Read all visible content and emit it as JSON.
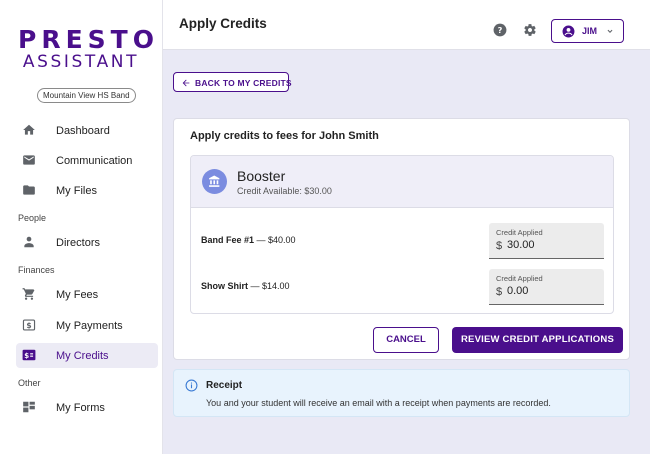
{
  "app": {
    "logo_top": "PRESTO",
    "logo_bottom": "ASSISTANT",
    "org_name": "Mountain View HS Band",
    "brand_color": "#4a0f8c"
  },
  "sidebar": {
    "items": [
      {
        "label": "Dashboard",
        "icon": "home-icon"
      },
      {
        "label": "Communication",
        "icon": "mail-icon"
      },
      {
        "label": "My Files",
        "icon": "folder-icon"
      },
      {
        "label": "Directors",
        "icon": "person-icon"
      },
      {
        "label": "My Fees",
        "icon": "cart-icon"
      },
      {
        "label": "My Payments",
        "icon": "dollar-box-icon"
      },
      {
        "label": "My Credits",
        "icon": "credit-icon",
        "active": true
      },
      {
        "label": "My Forms",
        "icon": "forms-icon"
      }
    ],
    "sections": {
      "people": "People",
      "finances": "Finances",
      "other": "Other"
    }
  },
  "header": {
    "title": "Apply Credits",
    "user_label": "JIM"
  },
  "back_button": {
    "label": "BACK TO MY CREDITS"
  },
  "card": {
    "title": "Apply credits to fees for John Smith",
    "source": {
      "name": "Booster",
      "available": "Credit Available: $30.00"
    },
    "fees": [
      {
        "name": "Band Fee #1",
        "amount": " — $40.00",
        "field_label": "Credit Applied",
        "currency": "$",
        "value": "30.00"
      },
      {
        "name": "Show Shirt",
        "amount": " — $14.00",
        "field_label": "Credit Applied",
        "currency": "$",
        "value": "0.00"
      }
    ]
  },
  "actions": {
    "cancel": "CANCEL",
    "review": "REVIEW CREDIT APPLICATIONS"
  },
  "receipt": {
    "title": "Receipt",
    "text": "You and your student will receive an email with a receipt when payments are recorded."
  }
}
